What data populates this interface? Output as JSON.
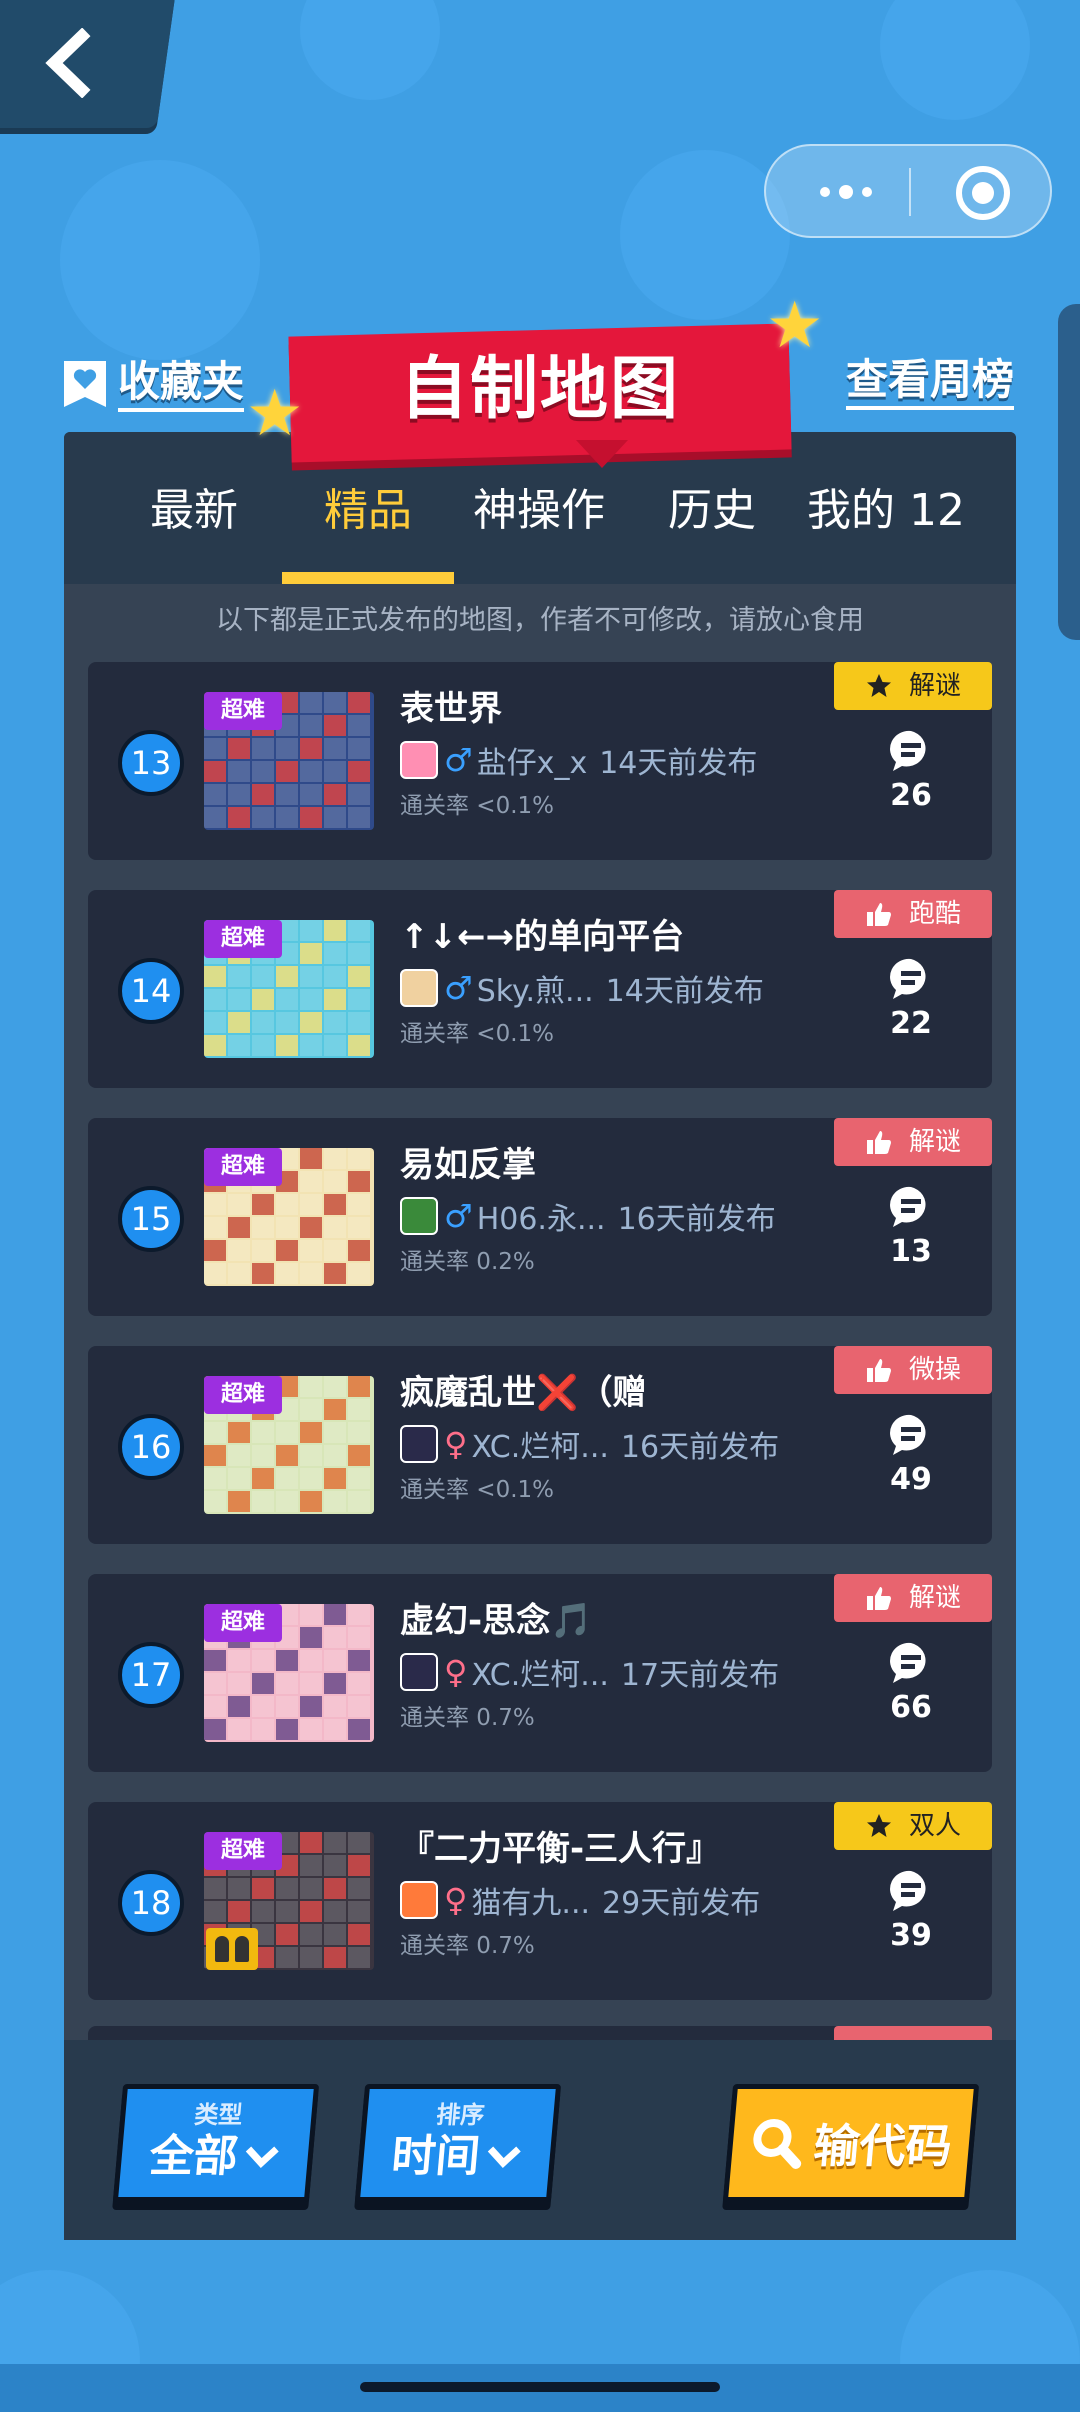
{
  "header": {
    "favorites_label": "收藏夹",
    "title": "自制地图",
    "weekly_label": "查看周榜"
  },
  "tabs": [
    {
      "label": "最新",
      "active": false
    },
    {
      "label": "精品",
      "active": true
    },
    {
      "label": "神操作",
      "active": false
    },
    {
      "label": "历史",
      "active": false
    },
    {
      "label": "我的 12",
      "active": false
    }
  ],
  "notice": "以下都是正式发布的地图，作者不可修改，请放心食用",
  "maps": [
    {
      "rank": "13",
      "difficulty": "超难",
      "title": "表世界",
      "gender": "♂",
      "author": "盐仔x_x",
      "published": "14天前发布",
      "pass_rate": "通关率 <0.1%",
      "tag": "解谜",
      "tag_style": "star",
      "comments": "26",
      "thumb_bg": "#2f4a8a",
      "thumb_fg": "#d94444",
      "avatar_color": "#ff8fb3"
    },
    {
      "rank": "14",
      "difficulty": "超难",
      "title": "↑↓←→的单向平台",
      "gender": "♂",
      "author": "Sky.煎...",
      "published": "14天前发布",
      "pass_rate": "通关率 <0.1%",
      "tag": "跑酷",
      "tag_style": "thumb",
      "comments": "22",
      "thumb_bg": "#57c7e0",
      "thumb_fg": "#f2e17a",
      "avatar_color": "#f0d1a0"
    },
    {
      "rank": "15",
      "difficulty": "超难",
      "title": "易如反掌",
      "gender": "♂",
      "author": "H06.永...",
      "published": "16天前发布",
      "pass_rate": "通关率 0.2%",
      "tag": "解谜",
      "tag_style": "thumb",
      "comments": "13",
      "thumb_bg": "#f2e3b3",
      "thumb_fg": "#c7503d",
      "avatar_color": "#3a8a3a"
    },
    {
      "rank": "16",
      "difficulty": "超难",
      "title": "疯魔乱世❌（赠",
      "gender": "♀",
      "author": "XC.烂柯...",
      "published": "16天前发布",
      "pass_rate": "通关率 <0.1%",
      "tag": "微操",
      "tag_style": "thumb",
      "comments": "49",
      "thumb_bg": "#d8e6b8",
      "thumb_fg": "#e0733a",
      "avatar_color": "#2a2a4a"
    },
    {
      "rank": "17",
      "difficulty": "超难",
      "title": "虚幻-思念🎵",
      "gender": "♀",
      "author": "XC.烂柯...",
      "published": "17天前发布",
      "pass_rate": "通关率 0.7%",
      "tag": "解谜",
      "tag_style": "thumb",
      "comments": "66",
      "thumb_bg": "#f3b8c8",
      "thumb_fg": "#6a4a8a",
      "avatar_color": "#2a2a4a"
    },
    {
      "rank": "18",
      "difficulty": "超难",
      "title": "『二力平衡-三人行』",
      "gender": "♀",
      "author": "猫有九...",
      "published": "29天前发布",
      "pass_rate": "通关率 0.7%",
      "tag": "双人",
      "tag_style": "star",
      "comments": "39",
      "thumb_bg": "#3a3540",
      "thumb_fg": "#d64a4a",
      "avatar_color": "#ff7a3a",
      "duo_badge": true
    }
  ],
  "bottom": {
    "type_small": "类型",
    "type_value": "全部",
    "sort_small": "排序",
    "sort_value": "时间",
    "code_label": "输代码"
  },
  "colors": {
    "accent": "#ffcc3a",
    "tab_active": "#ffcc3a",
    "tag_yellow": "#f6c81a",
    "tag_red": "#e8646f",
    "rank_blue": "#1f8ff0",
    "difficulty": "#9c2fe0",
    "banner_red": "#e4173b"
  },
  "icons": {
    "back": "chevron-left-icon",
    "more": "more-dots-icon",
    "close": "target-close-icon",
    "favorites": "heart-bookmark-icon",
    "comment": "speech-bubble-icon",
    "star_tag": "star-icon",
    "thumb_tag": "thumbs-up-icon",
    "search": "magnifier-icon",
    "dropdown": "chevron-down-icon"
  }
}
